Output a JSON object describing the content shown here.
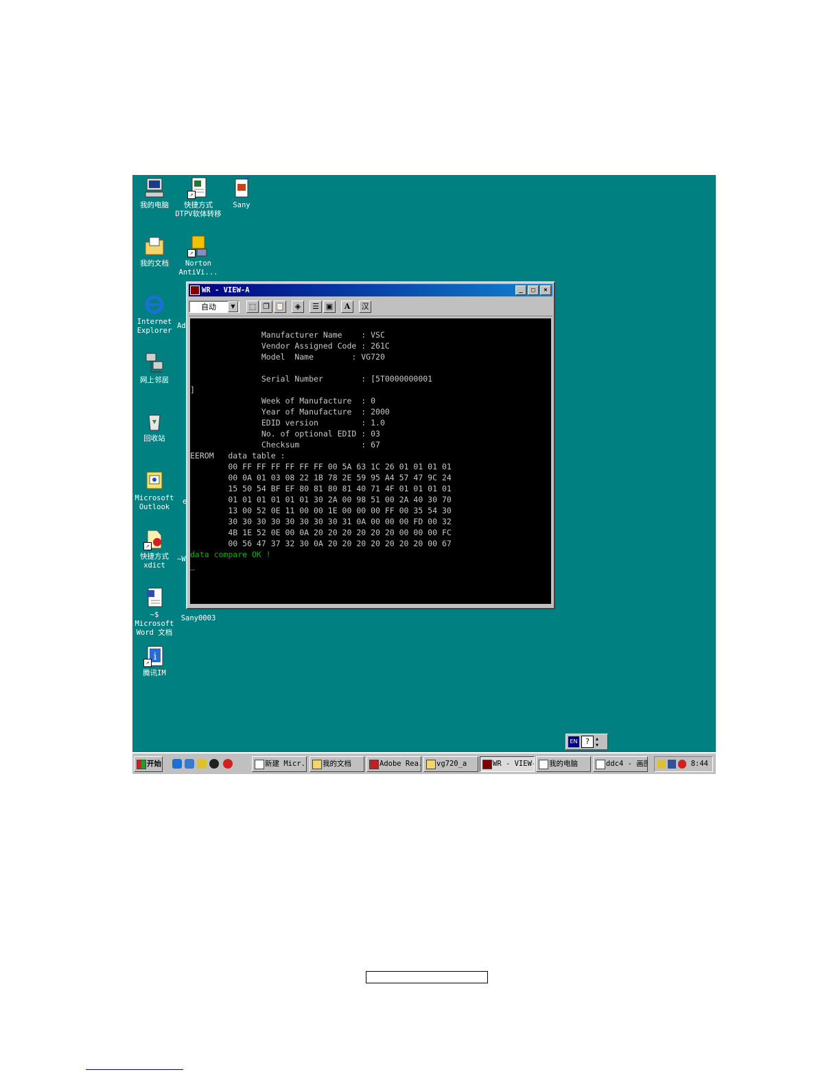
{
  "desktop_icons": [
    {
      "label": "我的电脑",
      "icon": "my-computer-icon"
    },
    {
      "label": "快捷方式\nDTPV软体转移",
      "icon": "excel-shortcut-icon"
    },
    {
      "label": "Sany",
      "icon": "image-file-icon"
    },
    {
      "label": "我的文档",
      "icon": "my-documents-icon"
    },
    {
      "label": "Norton\nAntiVi...",
      "icon": "norton-antivirus-icon"
    },
    {
      "label": "Internet\nExplorer",
      "icon": "internet-explorer-icon"
    },
    {
      "label": "网上邻居",
      "icon": "network-neighborhood-icon"
    },
    {
      "label": "回收站",
      "icon": "recycle-bin-icon"
    },
    {
      "label": "Microsoft\nOutlook",
      "icon": "outlook-icon"
    },
    {
      "label": "快捷方式\nxdict",
      "icon": "xdict-shortcut-icon"
    },
    {
      "label": "~$ Microsoft\nWord 文档",
      "icon": "word-document-icon"
    },
    {
      "label": "Sany0003",
      "icon": "image-file-icon"
    },
    {
      "label": "腾讯IM",
      "icon": "tencent-im-shortcut-icon"
    }
  ],
  "partial_labels": [
    "Ad",
    "~W",
    "e"
  ],
  "window": {
    "title": "WR - VIEW-A",
    "font_select": "自动",
    "toolbar_icons": [
      "mark-icon",
      "copy-icon",
      "paste-icon",
      "fullscreen-icon",
      "properties-icon",
      "background-icon",
      "font-icon",
      "chinese-input-icon"
    ],
    "font_button": "A",
    "ime_button": "汉"
  },
  "console": {
    "lines": [
      "               Manufacturer Name    : VSC",
      "               Vendor Assigned Code : 261C",
      "               Model  Name        : VG720",
      "",
      "               Serial Number        : [5T0000000001",
      "]",
      "               Week of Manufacture  : 0",
      "               Year of Manufacture  : 2000",
      "               EDID version         : 1.0",
      "               No. of optional EDID : 03",
      "               Checksum             : 67",
      "EEROM   data table :",
      "        00 FF FF FF FF FF FF 00 5A 63 1C 26 01 01 01 01",
      "        00 0A 01 03 08 22 1B 78 2E 59 95 A4 57 47 9C 24",
      "        15 50 54 BF EF 80 81 80 81 40 71 4F 01 01 01 01",
      "        01 01 01 01 01 01 30 2A 00 98 51 00 2A 40 30 70",
      "        13 00 52 0E 11 00 00 1E 00 00 00 FF 00 35 54 30",
      "        30 30 30 30 30 30 30 30 31 0A 00 00 00 FD 00 32",
      "        4B 1E 52 0E 00 0A 20 20 20 20 20 20 00 00 00 FC",
      "        00 56 47 37 32 30 0A 20 20 20 20 20 20 20 00 67"
    ],
    "status": "data compare OK !",
    "cursor": "_"
  },
  "ime": {
    "lang": "EN",
    "help": "?"
  },
  "taskbar": {
    "start": "开始",
    "tasks": [
      "新建 Micr...",
      "我的文档",
      "Adobe Rea...",
      "vg720_a",
      "WR - VIEW-A",
      "我的电脑",
      "ddc4 - 画图"
    ],
    "active_task": "WR - VIEW-A",
    "clock": "8:44"
  },
  "colors": {
    "desktop": "#008080",
    "titlebar": "#000080",
    "console_bg": "#000000",
    "status_text": "#00b400"
  }
}
